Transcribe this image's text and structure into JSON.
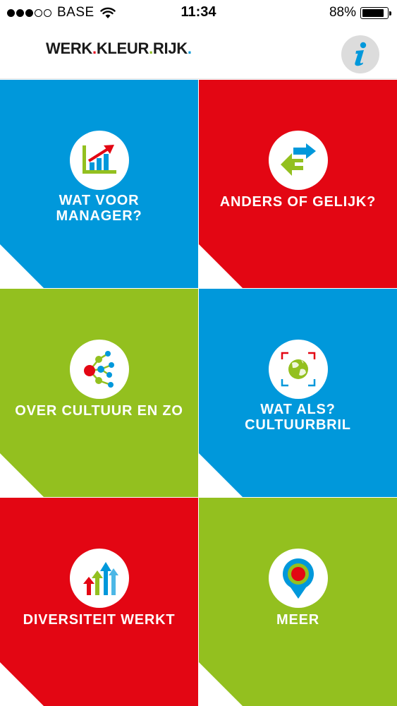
{
  "status_bar": {
    "carrier": "BASE",
    "time": "11:34",
    "battery_percent": "88%",
    "battery_level": 0.88,
    "signal_bars_filled": 3,
    "signal_bars_total": 5,
    "wifi_icon": "wifi-icon"
  },
  "header": {
    "logo_parts": [
      "WERK",
      ".",
      "KLEUR",
      ".",
      "RIJK",
      "."
    ],
    "info_icon": "info-icon"
  },
  "colors": {
    "blue": "#0098db",
    "red": "#e30613",
    "green": "#93c01f",
    "white": "#ffffff"
  },
  "tiles": [
    {
      "lines": [
        "WAT VOOR",
        "MANAGER?"
      ],
      "icon": "growth-chart-icon",
      "color": "blue"
    },
    {
      "lines": [
        "ANDERS OF GELIJK?"
      ],
      "icon": "exchange-arrows-icon",
      "color": "red"
    },
    {
      "lines": [
        "OVER CULTUUR EN ZO"
      ],
      "icon": "network-nodes-icon",
      "color": "green"
    },
    {
      "lines": [
        "WAT ALS?",
        "CULTUURBRIL"
      ],
      "icon": "globe-focus-icon",
      "color": "blue"
    },
    {
      "lines": [
        "DIVERSITEIT WERKT"
      ],
      "icon": "rising-arrows-icon",
      "color": "red"
    },
    {
      "lines": [
        "MEER"
      ],
      "icon": "map-pin-icon",
      "color": "green"
    }
  ]
}
